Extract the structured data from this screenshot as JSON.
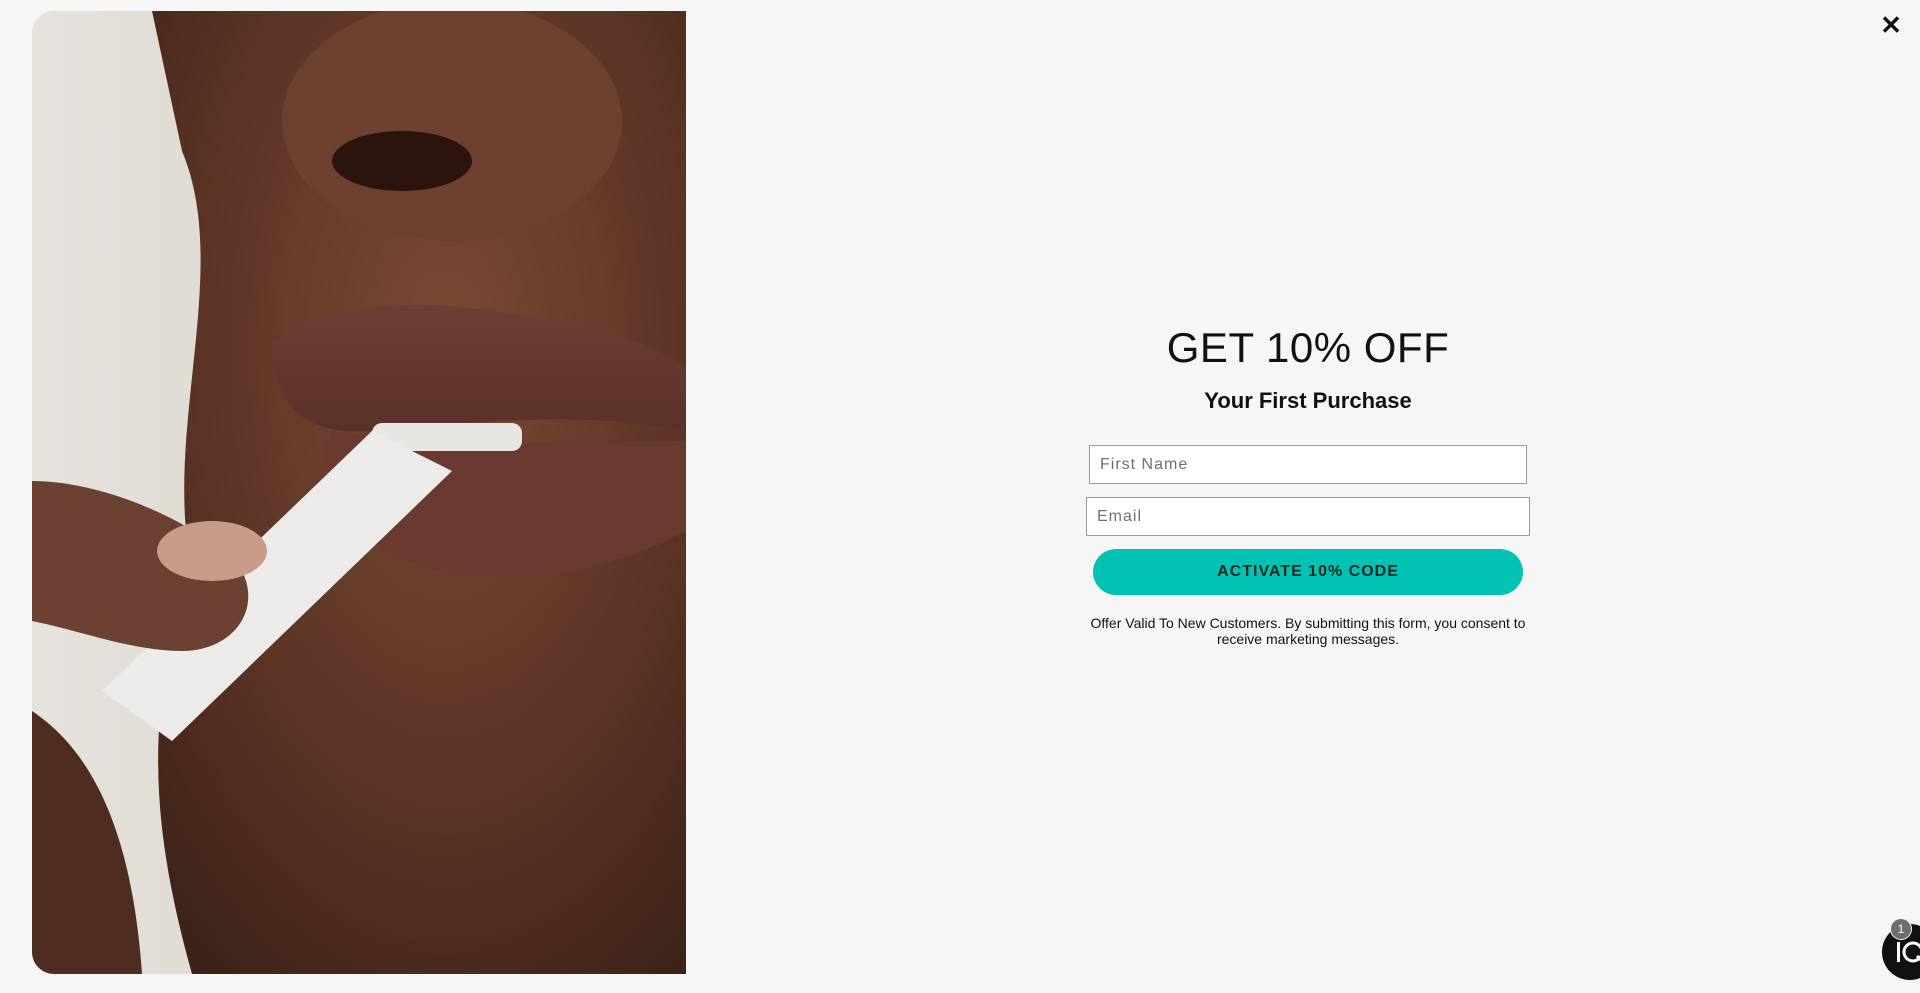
{
  "popup": {
    "headline": "GET 10% OFF",
    "subhead": "Your First Purchase",
    "first_name_placeholder": "First Name",
    "email_placeholder": "Email",
    "cta_label": "ACTIVATE 10% CODE",
    "disclaimer": "Offer Valid To New Customers. By submitting this form, you consent to receive marketing messages.",
    "close_icon": "close-icon",
    "accent_color": "#00c3b3"
  },
  "widget": {
    "icon": "chat-logo-icon",
    "badge_count": "1",
    "status_color": "#2ecc40"
  }
}
